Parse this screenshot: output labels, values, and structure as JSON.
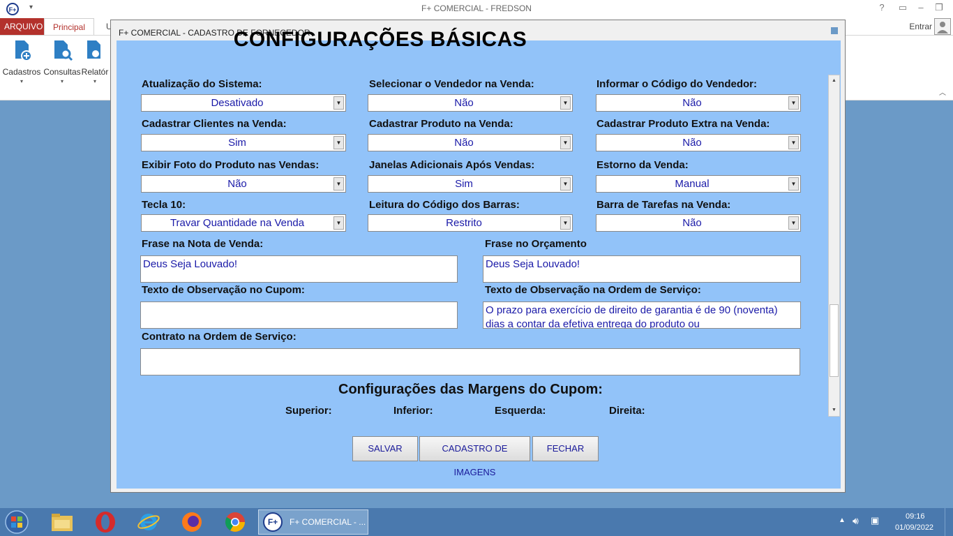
{
  "app": {
    "window_title": "F+ COMERCIAL - FREDSON",
    "help": "?",
    "tabs": {
      "arquivo": "ARQUIVO",
      "principal": "Principal",
      "partial": "U"
    },
    "entrar": "Entrar",
    "ribbon": [
      {
        "label": "Cadastros",
        "icon": "add-document-icon"
      },
      {
        "label": "Consultas",
        "icon": "search-document-icon"
      },
      {
        "label": "Relatór",
        "icon": "report-icon"
      }
    ]
  },
  "dialog": {
    "title": "F+ COMERCIAL - CADASTRO DE FORNECEDOR",
    "heading": "CONFIGURAÇÕES BÁSICAS",
    "fields": [
      {
        "label": "Atualização do Sistema:",
        "value": "Desativado"
      },
      {
        "label": "Selecionar o Vendedor na Venda:",
        "value": "Não"
      },
      {
        "label": "Informar o Código do Vendedor:",
        "value": "Não"
      },
      {
        "label": "Cadastrar Clientes na Venda:",
        "value": "Sim"
      },
      {
        "label": "Cadastrar Produto na Venda:",
        "value": "Não"
      },
      {
        "label": "Cadastrar Produto Extra na Venda:",
        "value": "Não"
      },
      {
        "label": "Exibir Foto do Produto nas Vendas:",
        "value": "Não"
      },
      {
        "label": "Janelas Adicionais Após Vendas:",
        "value": "Sim"
      },
      {
        "label": "Estorno da Venda:",
        "value": "Manual"
      },
      {
        "label": "Tecla 10:",
        "value": "Travar Quantidade na Venda"
      },
      {
        "label": "Leitura do Código dos Barras:",
        "value": "Restrito"
      },
      {
        "label": "Barra de Tarefas na Venda:",
        "value": "Não"
      }
    ],
    "frase_nota": {
      "label": "Frase na Nota de Venda:",
      "value": "Deus Seja Louvado!"
    },
    "frase_orcamento": {
      "label": "Frase no Orçamento",
      "value": "Deus Seja Louvado!"
    },
    "obs_cupom": {
      "label": "Texto de Observação no Cupom:",
      "value": ""
    },
    "obs_os": {
      "label": "Texto de Observação na Ordem de Serviço:",
      "value": "O prazo para exercício de direito de garantia é de 90 (noventa) dias a contar da efetiva entrega do produto ou"
    },
    "contrato": {
      "label": "Contrato na Ordem de Serviço:",
      "value": ""
    },
    "margens": {
      "heading": "Configurações das Margens do Cupom:",
      "superior": "Superior:",
      "inferior": "Inferior:",
      "esquerda": "Esquerda:",
      "direita": "Direita:"
    },
    "buttons": {
      "salvar": "SALVAR",
      "imagens": "CADASTRO DE IMAGENS",
      "fechar": "FECHAR"
    }
  },
  "taskbar": {
    "active_task": "F+ COMERCIAL - ...",
    "active_badge": "F+",
    "time": "09:16",
    "date": "01/09/2022"
  }
}
